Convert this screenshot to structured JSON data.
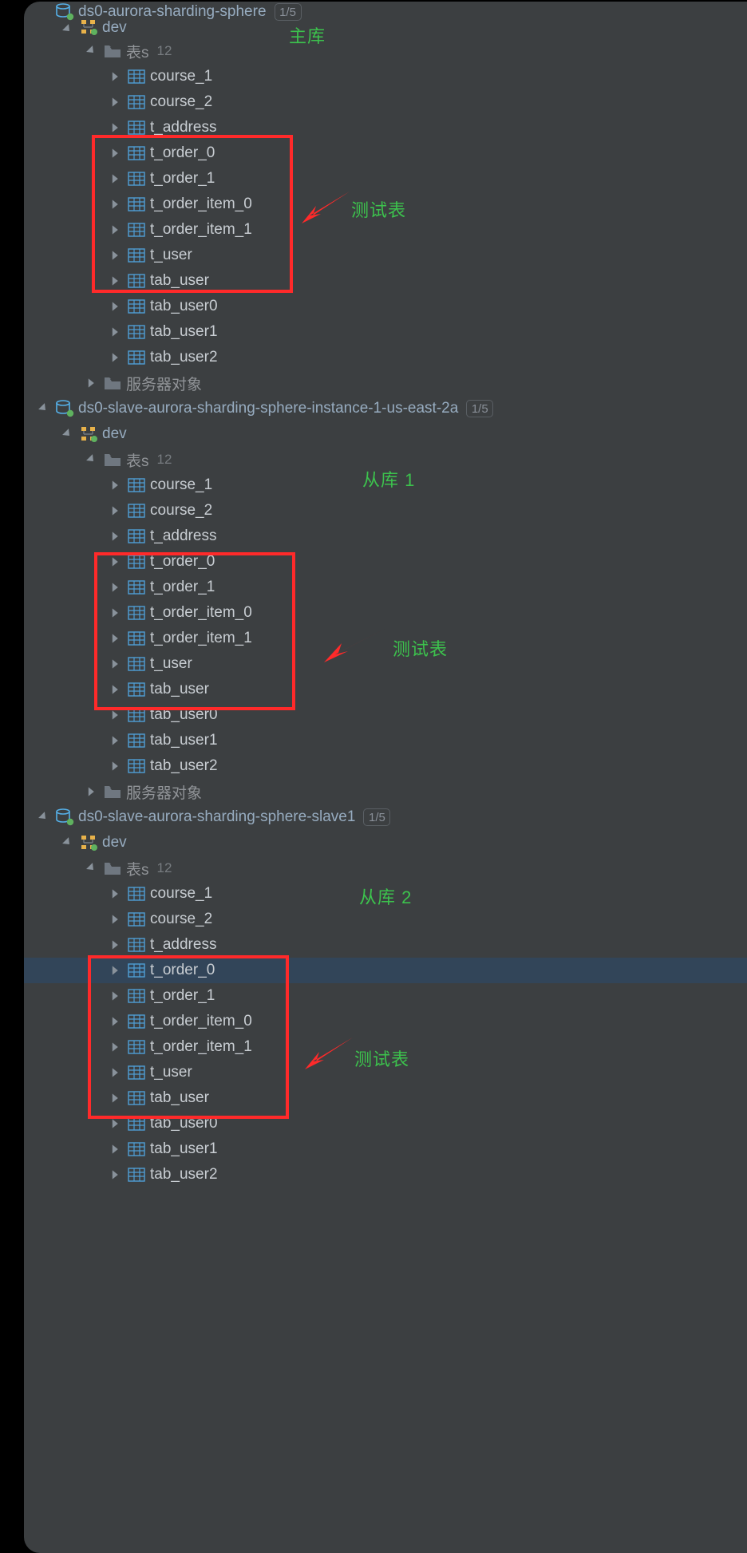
{
  "badge": "1/5",
  "tables_label": "表s",
  "tables_count": "12",
  "server_objects_label": "服务器对象",
  "dev_label": "dev",
  "datasources": [
    {
      "name": "ds0-aurora-sharding-sphere",
      "anno": "主库"
    },
    {
      "name": "ds0-slave-aurora-sharding-sphere-instance-1-us-east-2a",
      "anno": "从库 1"
    },
    {
      "name": "ds0-slave-aurora-sharding-sphere-slave1",
      "anno": "从库 2"
    }
  ],
  "tables": [
    "course_1",
    "course_2",
    "t_address",
    "t_order_0",
    "t_order_1",
    "t_order_item_0",
    "t_order_item_1",
    "t_user",
    "tab_user",
    "tab_user0",
    "tab_user1",
    "tab_user2"
  ],
  "test_label": "测试表"
}
